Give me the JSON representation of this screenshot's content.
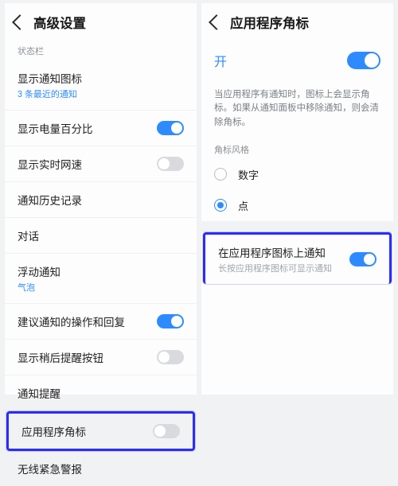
{
  "left": {
    "title": "高级设置",
    "sectionLabel": "状态栏",
    "rows": {
      "showNotifIcons": {
        "label": "显示通知图标",
        "sub": "3 条最近的通知"
      },
      "showBattery": {
        "label": "显示电量百分比"
      },
      "showNetSpeed": {
        "label": "显示实时网速"
      },
      "notifHistory": {
        "label": "通知历史记录"
      },
      "conversations": {
        "label": "对话"
      },
      "floatingNotif": {
        "label": "浮动通知",
        "sub": "气泡"
      },
      "suggestActions": {
        "label": "建议通知的操作和回复"
      },
      "remindLater": {
        "label": "显示稍后提醒按钮"
      },
      "notifReminder": {
        "label": "通知提醒"
      },
      "appBadges": {
        "label": "应用程序角标"
      },
      "wirelessAlert": {
        "label": "无线紧急警报"
      }
    }
  },
  "right": {
    "title": "应用程序角标",
    "master": {
      "label": "开"
    },
    "desc": "当应用程序有通知时，图标上会显示角标。如果从通知面板中移除通知，则会清除角标。",
    "styleLabel": "角标风格",
    "radios": {
      "number": "数字",
      "dot": "点"
    },
    "notifOnIcon": {
      "label": "在应用程序图标上通知",
      "sub": "长按应用程序图标可显示通知"
    }
  }
}
